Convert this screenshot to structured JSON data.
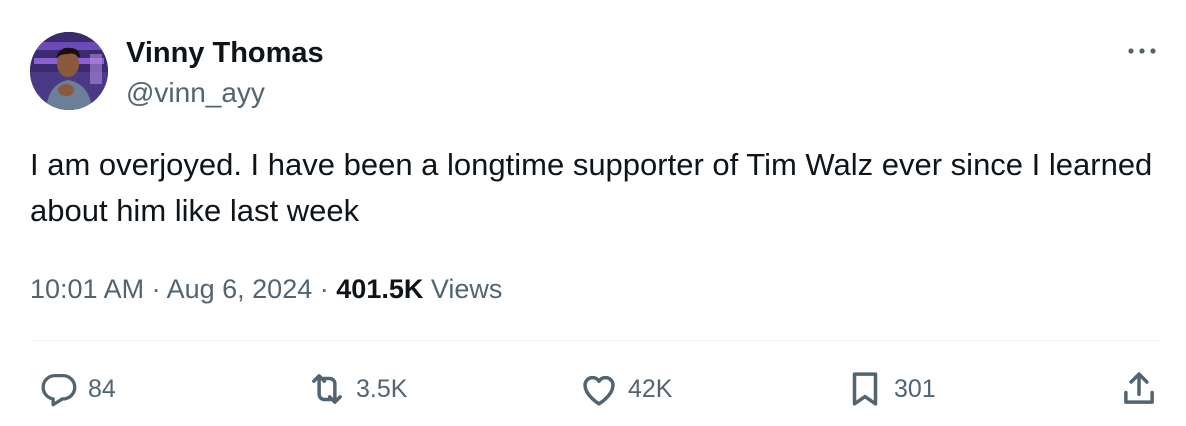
{
  "author": {
    "display_name": "Vinny Thomas",
    "handle": "@vinn_ayy",
    "avatar_icon": "profile-photo"
  },
  "tweet": {
    "text": "I am overjoyed. I have been a longtime supporter of Tim Walz ever since I learned about him like last week",
    "time": "10:01 AM",
    "date": "Aug 6, 2024",
    "separator": "·",
    "views_count": "401.5K",
    "views_label": "Views"
  },
  "actions": {
    "reply": {
      "icon": "reply-icon",
      "count": "84"
    },
    "retweet": {
      "icon": "retweet-icon",
      "count": "3.5K"
    },
    "like": {
      "icon": "heart-icon",
      "count": "42K"
    },
    "bookmark": {
      "icon": "bookmark-icon",
      "count": "301"
    },
    "share": {
      "icon": "share-icon"
    }
  },
  "colors": {
    "text_primary": "#0f1419",
    "text_secondary": "#536471",
    "divider": "#eff3f4"
  }
}
